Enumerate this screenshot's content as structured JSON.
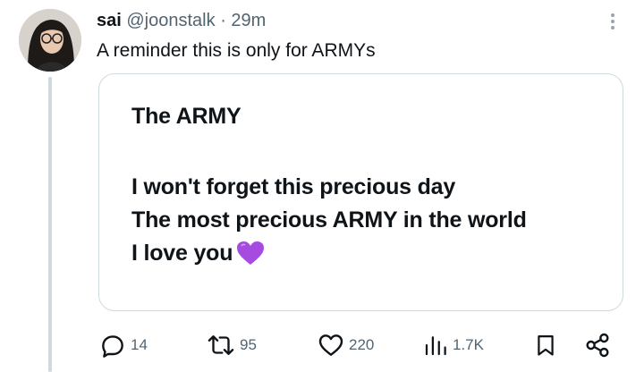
{
  "tweet": {
    "author_name": "sai",
    "author_handle": "@joonstalk",
    "separator": "·",
    "timestamp": "29m",
    "text": "A reminder this is only for ARMYs"
  },
  "card": {
    "title": "The ARMY",
    "lines": [
      "I won't forget this precious day",
      "The most precious ARMY in the world",
      "I love you"
    ],
    "emoji_icon": "purple-heart-emoji",
    "emoji_color": "#a64be0"
  },
  "actions": {
    "reply_count": "14",
    "retweet_count": "95",
    "like_count": "220",
    "view_count": "1.7K"
  },
  "colors": {
    "text_primary": "#0f1419",
    "text_secondary": "#536471",
    "border": "#cfd9de"
  }
}
